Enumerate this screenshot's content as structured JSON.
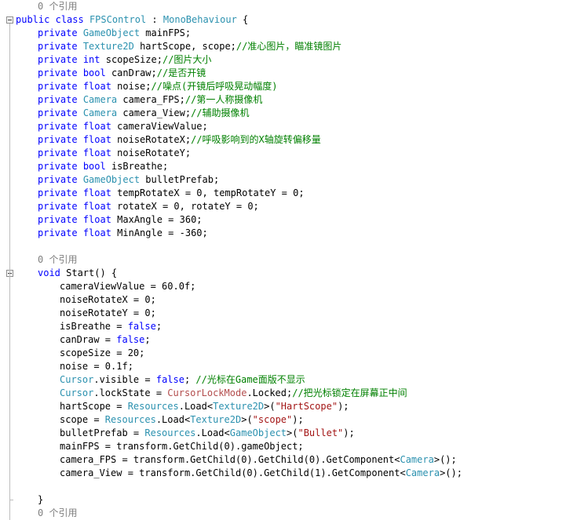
{
  "editor": {
    "lines": [
      {
        "kind": "lens",
        "indent": 1,
        "tokens": [
          {
            "t": "0 个引用",
            "c": "codelens"
          }
        ]
      },
      {
        "kind": "code",
        "indent": 0,
        "fold": true,
        "tokens": [
          {
            "t": "public",
            "c": "kw"
          },
          {
            "t": " ",
            "c": "plain"
          },
          {
            "t": "class",
            "c": "kw"
          },
          {
            "t": " ",
            "c": "plain"
          },
          {
            "t": "FPSControl",
            "c": "ty"
          },
          {
            "t": " : ",
            "c": "plain"
          },
          {
            "t": "MonoBehaviour",
            "c": "ty"
          },
          {
            "t": " {",
            "c": "plain"
          }
        ]
      },
      {
        "kind": "code",
        "indent": 1,
        "tokens": [
          {
            "t": "private",
            "c": "kw"
          },
          {
            "t": " ",
            "c": "plain"
          },
          {
            "t": "GameObject",
            "c": "ty"
          },
          {
            "t": " mainFPS;",
            "c": "plain"
          }
        ]
      },
      {
        "kind": "code",
        "indent": 1,
        "tokens": [
          {
            "t": "private",
            "c": "kw"
          },
          {
            "t": " ",
            "c": "plain"
          },
          {
            "t": "Texture2D",
            "c": "ty"
          },
          {
            "t": " hartScope, scope;",
            "c": "plain"
          },
          {
            "t": "//准心图片，瞄准镜图片",
            "c": "cm"
          }
        ]
      },
      {
        "kind": "code",
        "indent": 1,
        "tokens": [
          {
            "t": "private",
            "c": "kw"
          },
          {
            "t": " ",
            "c": "plain"
          },
          {
            "t": "int",
            "c": "kw"
          },
          {
            "t": " scopeSize;",
            "c": "plain"
          },
          {
            "t": "//图片大小",
            "c": "cm"
          }
        ]
      },
      {
        "kind": "code",
        "indent": 1,
        "tokens": [
          {
            "t": "private",
            "c": "kw"
          },
          {
            "t": " ",
            "c": "plain"
          },
          {
            "t": "bool",
            "c": "kw"
          },
          {
            "t": " canDraw;",
            "c": "plain"
          },
          {
            "t": "//是否开镜",
            "c": "cm"
          }
        ]
      },
      {
        "kind": "code",
        "indent": 1,
        "tokens": [
          {
            "t": "private",
            "c": "kw"
          },
          {
            "t": " ",
            "c": "plain"
          },
          {
            "t": "float",
            "c": "kw"
          },
          {
            "t": " noise;",
            "c": "plain"
          },
          {
            "t": "//噪点(开镜后呼吸晃动幅度)",
            "c": "cm"
          }
        ]
      },
      {
        "kind": "code",
        "indent": 1,
        "tokens": [
          {
            "t": "private",
            "c": "kw"
          },
          {
            "t": " ",
            "c": "plain"
          },
          {
            "t": "Camera",
            "c": "ty"
          },
          {
            "t": " camera_FPS;",
            "c": "plain"
          },
          {
            "t": "//第一人称摄像机",
            "c": "cm"
          }
        ]
      },
      {
        "kind": "code",
        "indent": 1,
        "tokens": [
          {
            "t": "private",
            "c": "kw"
          },
          {
            "t": " ",
            "c": "plain"
          },
          {
            "t": "Camera",
            "c": "ty"
          },
          {
            "t": " camera_View;",
            "c": "plain"
          },
          {
            "t": "//辅助摄像机",
            "c": "cm"
          }
        ]
      },
      {
        "kind": "code",
        "indent": 1,
        "tokens": [
          {
            "t": "private",
            "c": "kw"
          },
          {
            "t": " ",
            "c": "plain"
          },
          {
            "t": "float",
            "c": "kw"
          },
          {
            "t": " cameraViewValue;",
            "c": "plain"
          }
        ]
      },
      {
        "kind": "code",
        "indent": 1,
        "tokens": [
          {
            "t": "private",
            "c": "kw"
          },
          {
            "t": " ",
            "c": "plain"
          },
          {
            "t": "float",
            "c": "kw"
          },
          {
            "t": " noiseRotateX;",
            "c": "plain"
          },
          {
            "t": "//呼吸影响到的X轴旋转偏移量",
            "c": "cm"
          }
        ]
      },
      {
        "kind": "code",
        "indent": 1,
        "tokens": [
          {
            "t": "private",
            "c": "kw"
          },
          {
            "t": " ",
            "c": "plain"
          },
          {
            "t": "float",
            "c": "kw"
          },
          {
            "t": " noiseRotateY;",
            "c": "plain"
          }
        ]
      },
      {
        "kind": "code",
        "indent": 1,
        "tokens": [
          {
            "t": "private",
            "c": "kw"
          },
          {
            "t": " ",
            "c": "plain"
          },
          {
            "t": "bool",
            "c": "kw"
          },
          {
            "t": " isBreathe;",
            "c": "plain"
          }
        ]
      },
      {
        "kind": "code",
        "indent": 1,
        "tokens": [
          {
            "t": "private",
            "c": "kw"
          },
          {
            "t": " ",
            "c": "plain"
          },
          {
            "t": "GameObject",
            "c": "ty"
          },
          {
            "t": " bulletPrefab;",
            "c": "plain"
          }
        ]
      },
      {
        "kind": "code",
        "indent": 1,
        "tokens": [
          {
            "t": "private",
            "c": "kw"
          },
          {
            "t": " ",
            "c": "plain"
          },
          {
            "t": "float",
            "c": "kw"
          },
          {
            "t": " tempRotateX = 0, tempRotateY = 0;",
            "c": "plain"
          }
        ]
      },
      {
        "kind": "code",
        "indent": 1,
        "tokens": [
          {
            "t": "private",
            "c": "kw"
          },
          {
            "t": " ",
            "c": "plain"
          },
          {
            "t": "float",
            "c": "kw"
          },
          {
            "t": " rotateX = 0, rotateY = 0;",
            "c": "plain"
          }
        ]
      },
      {
        "kind": "code",
        "indent": 1,
        "tokens": [
          {
            "t": "private",
            "c": "kw"
          },
          {
            "t": " ",
            "c": "plain"
          },
          {
            "t": "float",
            "c": "kw"
          },
          {
            "t": " MaxAngle = 360;",
            "c": "plain"
          }
        ]
      },
      {
        "kind": "code",
        "indent": 1,
        "tokens": [
          {
            "t": "private",
            "c": "kw"
          },
          {
            "t": " ",
            "c": "plain"
          },
          {
            "t": "float",
            "c": "kw"
          },
          {
            "t": " MinAngle = -360;",
            "c": "plain"
          }
        ]
      },
      {
        "kind": "blank",
        "indent": 0,
        "tokens": []
      },
      {
        "kind": "lens",
        "indent": 1,
        "tokens": [
          {
            "t": "0 个引用",
            "c": "codelens"
          }
        ]
      },
      {
        "kind": "code",
        "indent": 1,
        "fold": true,
        "tokens": [
          {
            "t": "void",
            "c": "kw"
          },
          {
            "t": " Start() {",
            "c": "plain"
          }
        ]
      },
      {
        "kind": "code",
        "indent": 2,
        "tokens": [
          {
            "t": "cameraViewValue = 60.0f;",
            "c": "plain"
          }
        ]
      },
      {
        "kind": "code",
        "indent": 2,
        "tokens": [
          {
            "t": "noiseRotateX = 0;",
            "c": "plain"
          }
        ]
      },
      {
        "kind": "code",
        "indent": 2,
        "tokens": [
          {
            "t": "noiseRotateY = 0;",
            "c": "plain"
          }
        ]
      },
      {
        "kind": "code",
        "indent": 2,
        "tokens": [
          {
            "t": "isBreathe = ",
            "c": "plain"
          },
          {
            "t": "false",
            "c": "kw"
          },
          {
            "t": ";",
            "c": "plain"
          }
        ]
      },
      {
        "kind": "code",
        "indent": 2,
        "tokens": [
          {
            "t": "canDraw = ",
            "c": "plain"
          },
          {
            "t": "false",
            "c": "kw"
          },
          {
            "t": ";",
            "c": "plain"
          }
        ]
      },
      {
        "kind": "code",
        "indent": 2,
        "tokens": [
          {
            "t": "scopeSize = 20;",
            "c": "plain"
          }
        ]
      },
      {
        "kind": "code",
        "indent": 2,
        "tokens": [
          {
            "t": "noise = 0.1f;",
            "c": "plain"
          }
        ]
      },
      {
        "kind": "code",
        "indent": 2,
        "tokens": [
          {
            "t": "Cursor",
            "c": "ty"
          },
          {
            "t": ".visible = ",
            "c": "plain"
          },
          {
            "t": "false",
            "c": "kw"
          },
          {
            "t": "; ",
            "c": "plain"
          },
          {
            "t": "//光标在Game面版不显示",
            "c": "cm"
          }
        ]
      },
      {
        "kind": "code",
        "indent": 2,
        "tokens": [
          {
            "t": "Cursor",
            "c": "ty"
          },
          {
            "t": ".lockState = ",
            "c": "plain"
          },
          {
            "t": "CursorLockMode",
            "c": "en"
          },
          {
            "t": ".Locked;",
            "c": "plain"
          },
          {
            "t": "//把光标锁定在屏幕正中间",
            "c": "cm"
          }
        ]
      },
      {
        "kind": "code",
        "indent": 2,
        "tokens": [
          {
            "t": "hartScope = ",
            "c": "plain"
          },
          {
            "t": "Resources",
            "c": "ty"
          },
          {
            "t": ".Load<",
            "c": "plain"
          },
          {
            "t": "Texture2D",
            "c": "ty"
          },
          {
            "t": ">(",
            "c": "plain"
          },
          {
            "t": "\"HartScope\"",
            "c": "st"
          },
          {
            "t": ");",
            "c": "plain"
          }
        ]
      },
      {
        "kind": "code",
        "indent": 2,
        "tokens": [
          {
            "t": "scope = ",
            "c": "plain"
          },
          {
            "t": "Resources",
            "c": "ty"
          },
          {
            "t": ".Load<",
            "c": "plain"
          },
          {
            "t": "Texture2D",
            "c": "ty"
          },
          {
            "t": ">(",
            "c": "plain"
          },
          {
            "t": "\"scope\"",
            "c": "st"
          },
          {
            "t": ");",
            "c": "plain"
          }
        ]
      },
      {
        "kind": "code",
        "indent": 2,
        "tokens": [
          {
            "t": "bulletPrefab = ",
            "c": "plain"
          },
          {
            "t": "Resources",
            "c": "ty"
          },
          {
            "t": ".Load<",
            "c": "plain"
          },
          {
            "t": "GameObject",
            "c": "ty"
          },
          {
            "t": ">(",
            "c": "plain"
          },
          {
            "t": "\"Bullet\"",
            "c": "st"
          },
          {
            "t": ");",
            "c": "plain"
          }
        ]
      },
      {
        "kind": "code",
        "indent": 2,
        "tokens": [
          {
            "t": "mainFPS = transform.GetChild(0).gameObject;",
            "c": "plain"
          }
        ]
      },
      {
        "kind": "code",
        "indent": 2,
        "tokens": [
          {
            "t": "camera_FPS = transform.GetChild(0).GetChild(0).GetComponent<",
            "c": "plain"
          },
          {
            "t": "Camera",
            "c": "ty"
          },
          {
            "t": ">();",
            "c": "plain"
          }
        ]
      },
      {
        "kind": "code",
        "indent": 2,
        "tokens": [
          {
            "t": "camera_View = transform.GetChild(0).GetChild(1).GetComponent<",
            "c": "plain"
          },
          {
            "t": "Camera",
            "c": "ty"
          },
          {
            "t": ">();",
            "c": "plain"
          }
        ]
      },
      {
        "kind": "blank",
        "indent": 0,
        "tokens": []
      },
      {
        "kind": "code",
        "indent": 1,
        "tokens": [
          {
            "t": "}",
            "c": "plain"
          }
        ]
      },
      {
        "kind": "lens",
        "indent": 1,
        "tokens": [
          {
            "t": "0 个引用",
            "c": "codelens"
          }
        ]
      }
    ],
    "colors": {
      "keyword": "#0000ff",
      "type": "#2b91af",
      "comment": "#008000",
      "string": "#a31515",
      "enum": "#b34d4d",
      "codelens": "#808080",
      "text": "#000000",
      "background": "#ffffff"
    },
    "icons": {
      "fold": "collapse-minus-icon"
    }
  }
}
